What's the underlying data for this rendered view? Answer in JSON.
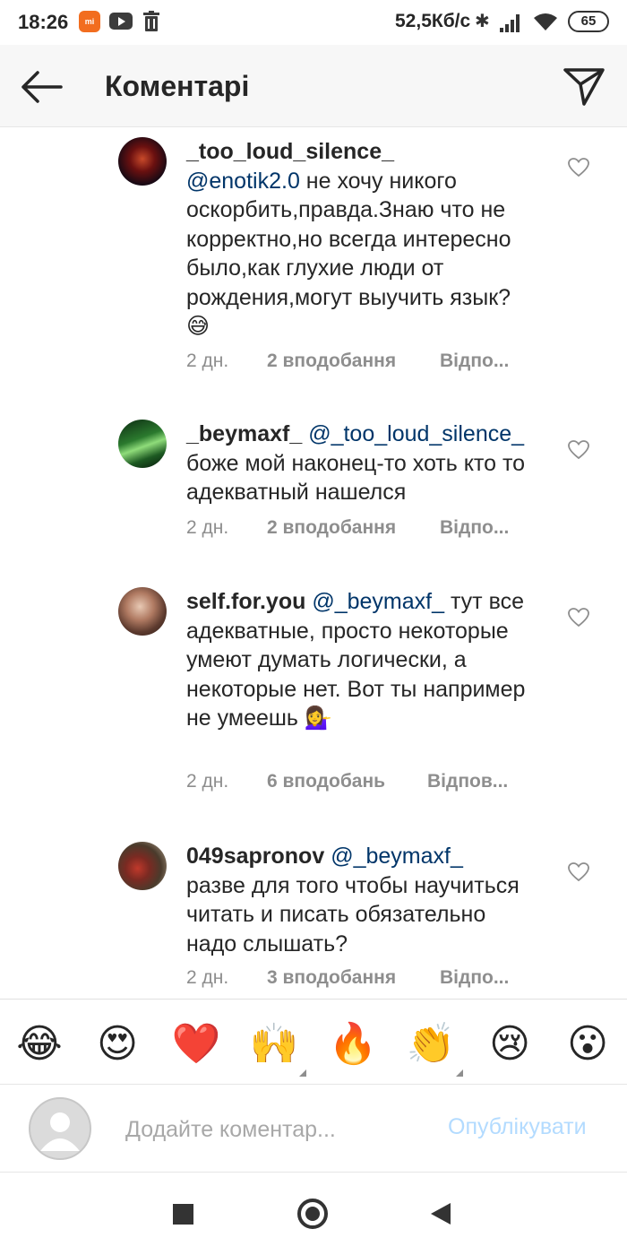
{
  "status_bar": {
    "time": "18:26",
    "mi_label": "mi",
    "speed": "52,5Кб/с",
    "battery": "65"
  },
  "header": {
    "title": "Коментарі"
  },
  "comments": [
    {
      "username": "_too_loud_silence_",
      "mention": "@enotik2.0",
      "text": " не хочу никого оскорбить,правда.Знаю что не корректно,но всегда интересно было,как глухие люди от рождения,могут выучить язык?😅",
      "time": "2 дн.",
      "likes": "2 вподобання",
      "reply": "Відпо..."
    },
    {
      "username": "_beymaxf_",
      "mention": "@_too_loud_silence_",
      "text": " боже мой наконец-то хоть кто то адекватный нашелся",
      "time": "2 дн.",
      "likes": "2 вподобання",
      "reply": "Відпо..."
    },
    {
      "username": "self.for.you",
      "mention": "@_beymaxf_",
      "text": " тут все адекватные, просто некоторые умеют думать логически, а некоторые нет. Вот ты например не умеешь 💁‍♀️",
      "time": "2 дн.",
      "likes": "6 вподобань",
      "reply": "Відпов..."
    },
    {
      "username": "049sapronov",
      "mention": "@_beymaxf_",
      "text": " разве для того чтобы научиться читать и писать обязательно надо слышать?",
      "time": "2 дн.",
      "likes": "3 вподобання",
      "reply": "Відпо..."
    }
  ],
  "emojis": [
    "😂",
    "😍",
    "❤️",
    "🙌",
    "🔥",
    "👏",
    "😢",
    "😮"
  ],
  "composer": {
    "placeholder": "Додайте коментар...",
    "publish_label": "Опублікувати"
  },
  "colors": {
    "mention": "#003569",
    "meta": "#8e8e8e",
    "publish_disabled": "#b3dbff"
  }
}
